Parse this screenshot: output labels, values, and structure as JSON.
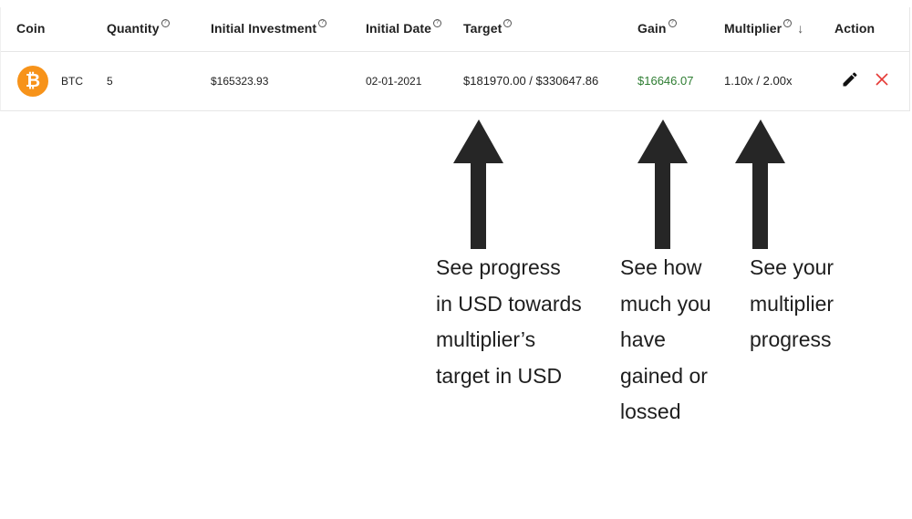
{
  "table": {
    "headers": {
      "coin": "Coin",
      "quantity": "Quantity",
      "initial_investment": "Initial Investment",
      "initial_date": "Initial Date",
      "target": "Target",
      "gain": "Gain",
      "multiplier": "Multiplier",
      "action": "Action"
    },
    "help_glyph": "?",
    "sort_glyph": "↓",
    "row": {
      "coin_symbol": "BTC",
      "coin_glyph": "₿",
      "quantity": "5",
      "initial_investment": "$165323.93",
      "initial_date": "02-01-2021",
      "target": "$181970.00 / $330647.86",
      "gain": "$16646.07",
      "multiplier": "1.10x / 2.00x"
    }
  },
  "icons": {
    "coin": "bitcoin-icon",
    "edit": "pencil-icon",
    "delete": "close-icon",
    "sort": "arrow-down-icon",
    "help": "help-icon"
  },
  "colors": {
    "gain": "#2e7d32",
    "delete": "#e53935",
    "bitcoin": "#f7931a",
    "arrow": "#262626"
  },
  "annotations": {
    "target": [
      "See progress",
      "in USD towards",
      "multiplier’s",
      "target in USD"
    ],
    "gain": [
      "See how",
      "much you",
      "have",
      "gained or",
      "lossed"
    ],
    "multiplier": [
      "See your",
      "multiplier",
      "progress"
    ]
  }
}
